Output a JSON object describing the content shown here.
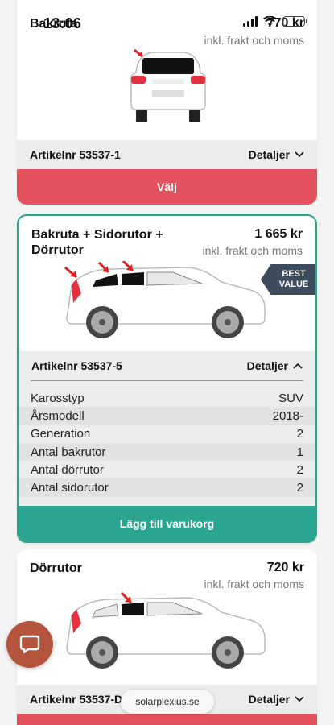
{
  "status_bar": {
    "time": "13:06"
  },
  "cards": [
    {
      "title": "Bakruta",
      "price": "770 kr",
      "price_note": "inkl. frakt och moms",
      "article": "Artikelnr 53537-1",
      "details_label": "Detaljer",
      "cta_label": "Välj"
    },
    {
      "title": "Bakruta + Sidorutor + Dörrutor",
      "price": "1 665 kr",
      "price_note": "inkl. frakt och moms",
      "badge": "BEST VALUE",
      "article": "Artikelnr 53537-5",
      "details_label": "Detaljer",
      "specs": [
        {
          "label": "Karosstyp",
          "value": "SUV"
        },
        {
          "label": "Årsmodell",
          "value": "2018-"
        },
        {
          "label": "Generation",
          "value": "2"
        },
        {
          "label": "Antal bakrutor",
          "value": "1"
        },
        {
          "label": "Antal dörrutor",
          "value": "2"
        },
        {
          "label": "Antal sidorutor",
          "value": "2"
        }
      ],
      "cta_label": "Lägg till varukorg"
    },
    {
      "title": "Dörrutor",
      "price": "720 kr",
      "price_note": "inkl. frakt och moms",
      "article": "Artikelnr 53537-D",
      "details_label": "Detaljer"
    }
  ],
  "url": "solarplexius.se",
  "colors": {
    "accent_green": "#2aa58f",
    "accent_red": "#e5525f",
    "chat": "#b5543c",
    "badge": "#3d4c5c"
  }
}
